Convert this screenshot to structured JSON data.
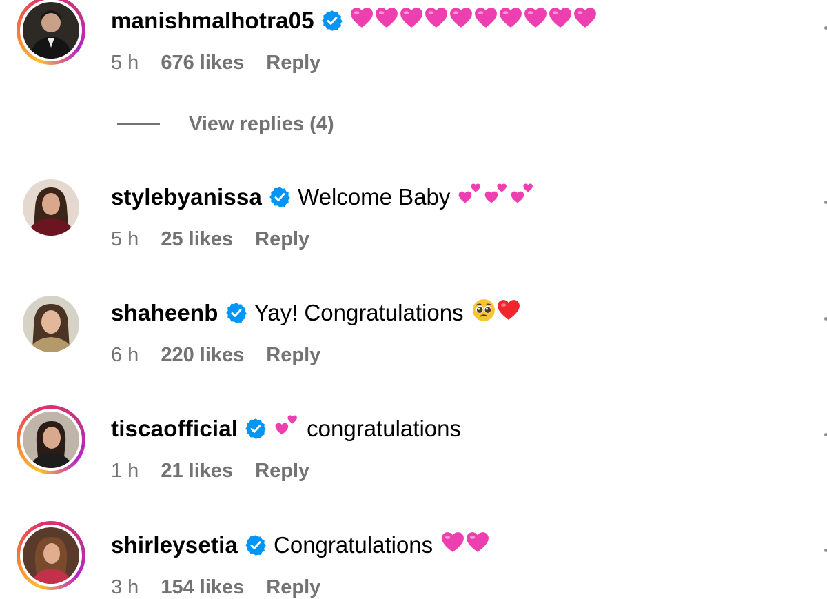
{
  "colors": {
    "secondary_text": "#737373",
    "verified_blue": "#0095f6",
    "heart_pink": "#ee3fb0"
  },
  "view_replies_label": "View replies (4)",
  "comments": [
    {
      "username": "manishmalhotra05",
      "verified": true,
      "text": "",
      "emoji": [
        "pink-heart-icon",
        "pink-heart-icon",
        "pink-heart-icon",
        "pink-heart-icon",
        "pink-heart-icon",
        "pink-heart-icon",
        "pink-heart-icon",
        "pink-heart-icon",
        "pink-heart-icon",
        "pink-heart-icon"
      ],
      "time": "5 h",
      "likes": "676 likes",
      "reply": "Reply",
      "story_ring": true
    },
    {
      "username": "stylebyanissa",
      "verified": true,
      "text": "Welcome Baby",
      "emoji": [
        "two-hearts-icon",
        "two-hearts-icon",
        "two-hearts-icon"
      ],
      "time": "5 h",
      "likes": "25 likes",
      "reply": "Reply",
      "story_ring": false
    },
    {
      "username": "shaheenb",
      "verified": true,
      "text": "Yay! Congratulations",
      "emoji": [
        "pleading-face-icon",
        "red-heart-icon"
      ],
      "time": "6 h",
      "likes": "220 likes",
      "reply": "Reply",
      "story_ring": false
    },
    {
      "username": "tiscaofficial",
      "verified": true,
      "text": "congratulations",
      "emoji": [
        "two-hearts-icon"
      ],
      "time": "1 h",
      "likes": "21 likes",
      "reply": "Reply",
      "story_ring": true
    },
    {
      "username": "shirleysetia",
      "verified": true,
      "text": "Congratulations",
      "emoji": [
        "pink-heart-icon",
        "pink-heart-icon"
      ],
      "time": "3 h",
      "likes": "154 likes",
      "reply": "Reply",
      "story_ring": true
    }
  ]
}
